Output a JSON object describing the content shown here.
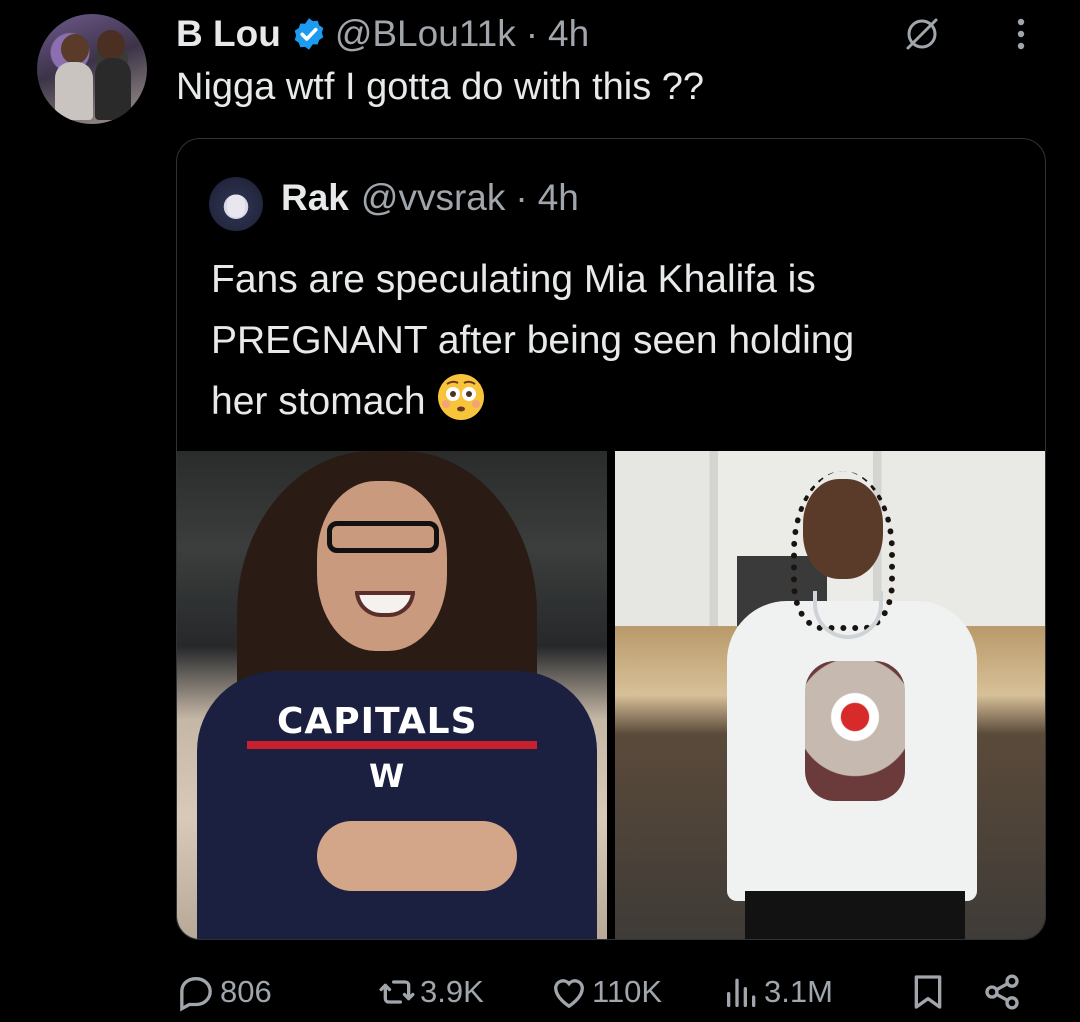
{
  "tweet": {
    "author_name": "B Lou",
    "handle": "@BLou11k",
    "separator": "·",
    "time": "4h",
    "text": "Nigga wtf I gotta do with this ??"
  },
  "quoted_tweet": {
    "author_name": "Rak",
    "handle": "@vvsrak",
    "separator": "·",
    "time": "4h",
    "text_lines": [
      "Fans are speculating Mia Khalifa is",
      "PREGNANT after being seen holding",
      "her stomach"
    ],
    "emoji": "flushed-face-emoji",
    "image_left_shirt_text": "CAPITALS",
    "image_left_shirt_letter": "W"
  },
  "actions": {
    "replies": "806",
    "reposts": "3.9K",
    "likes": "110K",
    "views": "3.1M"
  },
  "colors": {
    "background": "#000000",
    "text_primary": "#e7e9ea",
    "text_secondary": "#a0a6ab",
    "verified_blue": "#1d9bf0",
    "border": "#2f3336"
  }
}
